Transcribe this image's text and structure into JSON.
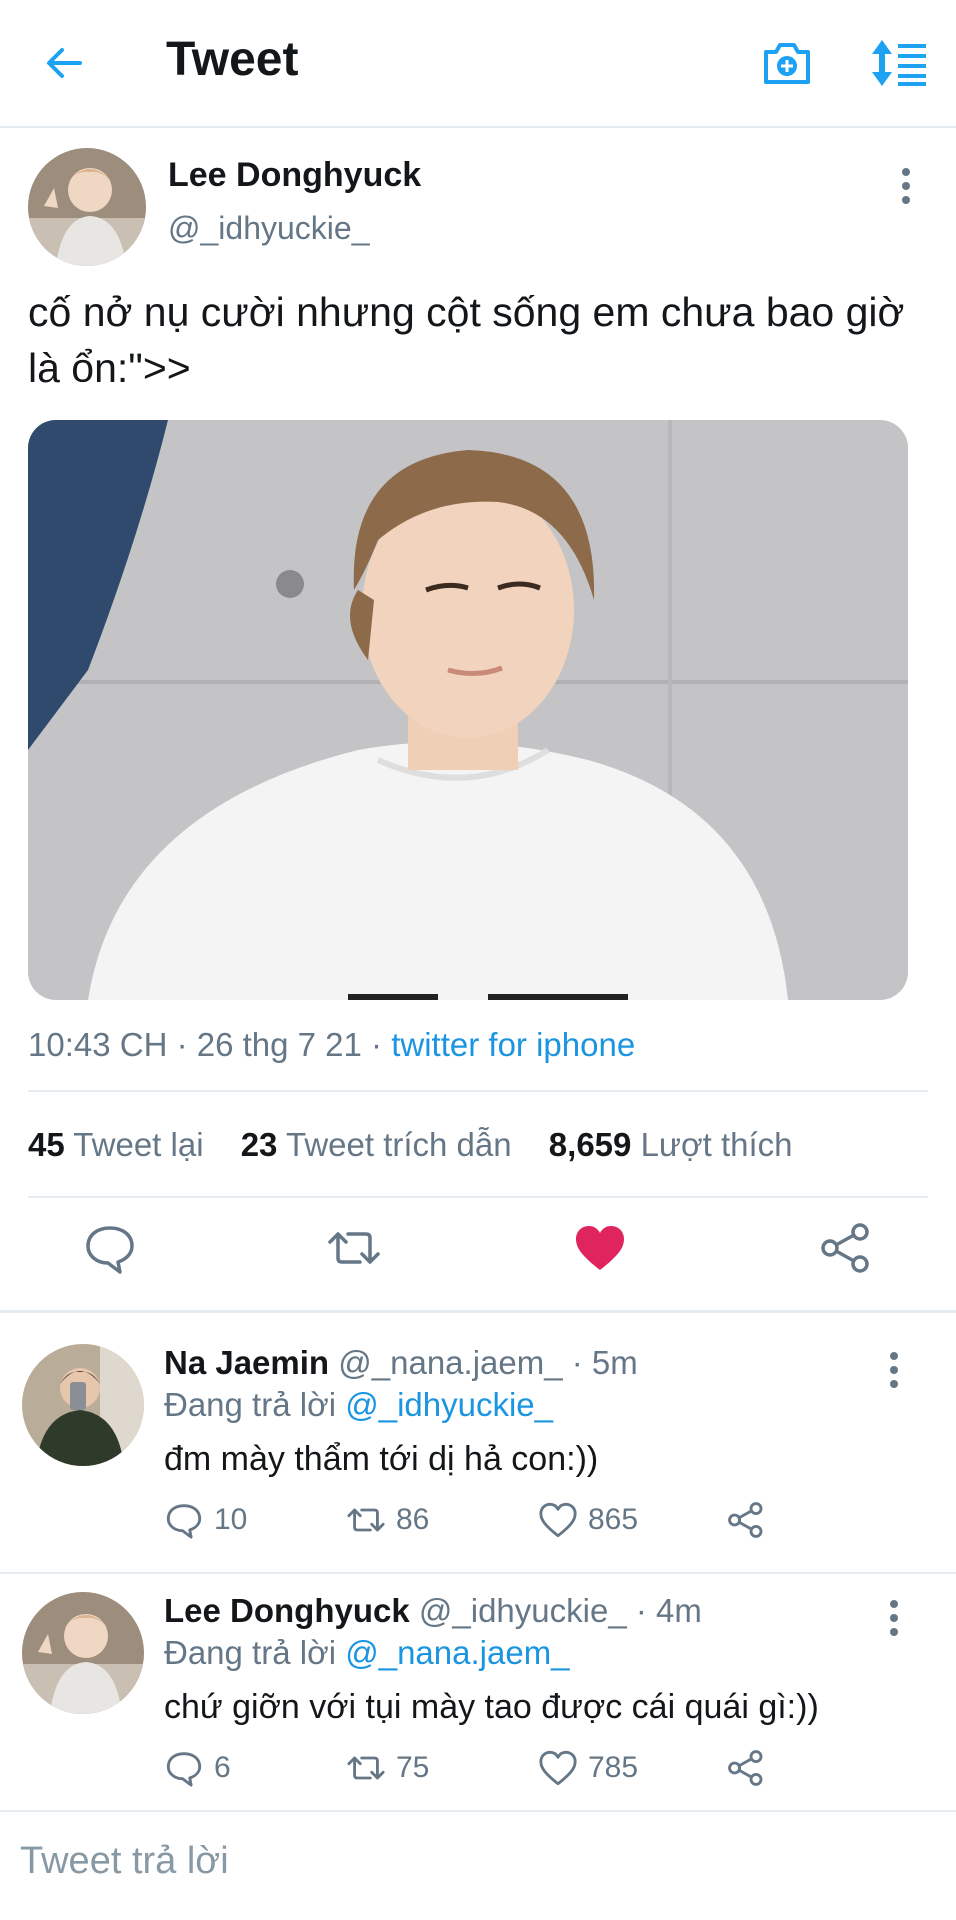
{
  "header": {
    "title": "Tweet",
    "back_icon": "arrow-left-icon",
    "camera_icon": "camera-plus-icon",
    "sort_icon": "sort-icon",
    "accent": "#1da1f2"
  },
  "tweet": {
    "author_name": "Lee Donghyuck",
    "author_handle": "@_idhyuckie_",
    "text": "cố nở nụ cười nhưng cột sống em chưa bao giờ là ổn:\">>",
    "timestamp": "10:43 CH · 26 thg 7 21 · ",
    "source": "twitter for iphone",
    "stats": {
      "retweets_count": "45",
      "retweets_label": "Tweet lại",
      "quotes_count": "23",
      "quotes_label": "Tweet trích dẫn",
      "likes_count": "8,659",
      "likes_label": "Lượt thích"
    },
    "liked": true,
    "like_color": "#e0245e"
  },
  "replies": [
    {
      "name": "Na Jaemin",
      "handle": "@_nana.jaem_",
      "time": " · 5m",
      "replying_prefix": "Đang trả lời ",
      "replying_to": "@_idhyuckie_",
      "text": "đm mày thẩm tới dị hả con:))",
      "reply_count": "10",
      "retweet_count": "86",
      "like_count": "865"
    },
    {
      "name": "Lee Donghyuck",
      "handle": "@_idhyuckie_",
      "time": " · 4m",
      "replying_prefix": "Đang trả lời ",
      "replying_to": "@_nana.jaem_",
      "text": "chứ giỡn với tụi mày tao được cái quái gì:))",
      "reply_count": "6",
      "retweet_count": "75",
      "like_count": "785"
    }
  ],
  "compose": {
    "placeholder": "Tweet trả lời"
  }
}
